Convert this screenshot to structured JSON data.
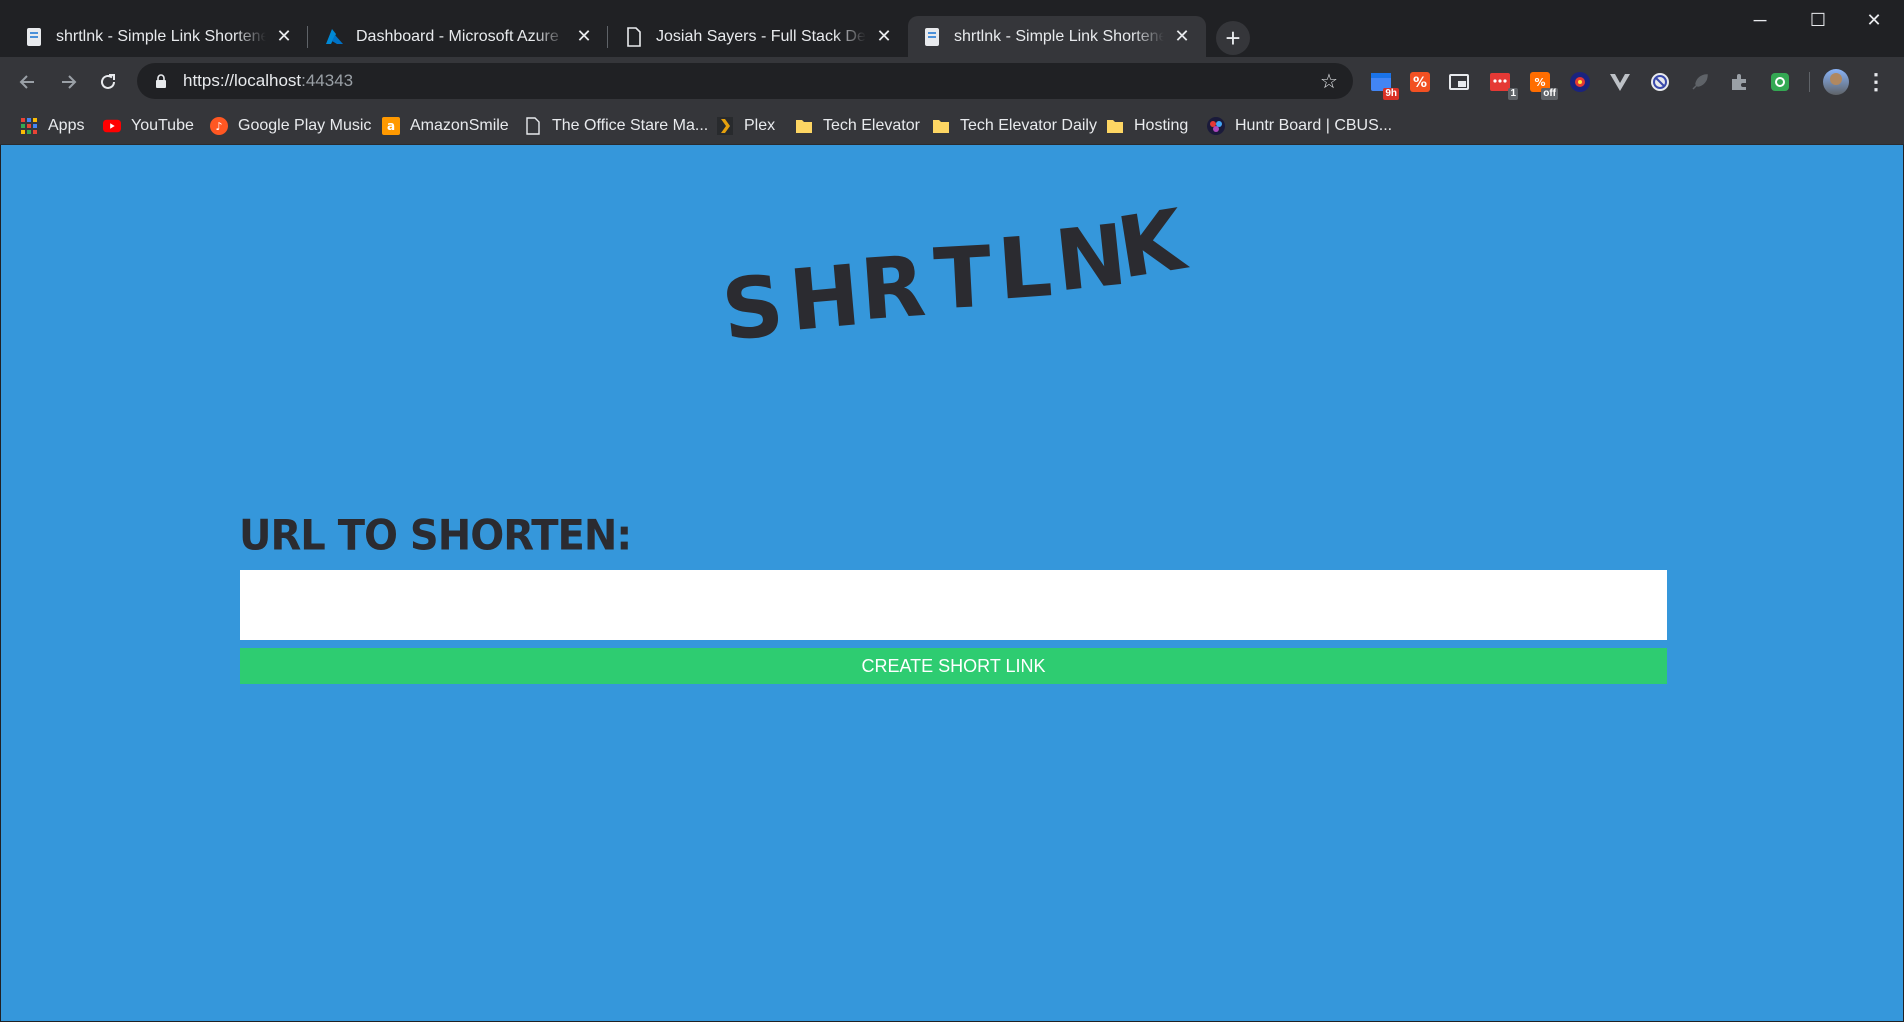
{
  "tabs": [
    {
      "title": "shrtlnk - Simple Link Shortener -",
      "favicon": "page-icon",
      "active": false
    },
    {
      "title": "Dashboard - Microsoft Azure",
      "favicon": "azure-icon",
      "active": false
    },
    {
      "title": "Josiah Sayers - Full Stack Develop",
      "favicon": "document-icon",
      "active": false
    },
    {
      "title": "shrtlnk - Simple Link Shortener -",
      "favicon": "page-icon",
      "active": true
    }
  ],
  "window_controls": {
    "minimize": "─",
    "maximize": "☐",
    "close": "✕"
  },
  "address_bar": {
    "url_prefix": "https://localhost",
    "url_port": ":44343"
  },
  "extensions": [
    {
      "name": "calendar-extension-icon",
      "badge": "9h",
      "badge_color": "#d93025"
    },
    {
      "name": "percent-extension-icon",
      "badge": "",
      "badge_color": ""
    },
    {
      "name": "picture-in-picture-icon",
      "badge": "",
      "badge_color": ""
    },
    {
      "name": "todo-extension-icon",
      "badge": "1",
      "badge_color": "#5f6368"
    },
    {
      "name": "coupon-extension-icon",
      "badge": "off",
      "badge_color": "#5f6368"
    },
    {
      "name": "globe-extension-icon",
      "badge": "",
      "badge_color": ""
    },
    {
      "name": "vue-devtools-icon",
      "badge": "",
      "badge_color": ""
    },
    {
      "name": "block-extension-icon",
      "badge": "",
      "badge_color": ""
    },
    {
      "name": "rocket-extension-icon",
      "badge": "",
      "badge_color": ""
    },
    {
      "name": "puzzle-extension-icon",
      "badge": "",
      "badge_color": ""
    },
    {
      "name": "gear-extension-icon",
      "badge": "",
      "badge_color": ""
    }
  ],
  "bookmarks": [
    {
      "label": "Apps",
      "icon": "apps-grid-icon"
    },
    {
      "label": "YouTube",
      "icon": "youtube-icon"
    },
    {
      "label": "Google Play Music",
      "icon": "play-music-icon"
    },
    {
      "label": "AmazonSmile",
      "icon": "amazon-icon"
    },
    {
      "label": "The Office Stare Ma...",
      "icon": "document-icon"
    },
    {
      "label": "Plex",
      "icon": "plex-icon"
    },
    {
      "label": "Tech Elevator",
      "icon": "folder-icon"
    },
    {
      "label": "Tech Elevator Daily",
      "icon": "folder-icon"
    },
    {
      "label": "Hosting",
      "icon": "folder-icon"
    },
    {
      "label": "Huntr Board | CBUS...",
      "icon": "huntr-icon"
    }
  ],
  "page": {
    "logo_text": "shrtlnk",
    "logo_letters": [
      "S",
      "H",
      "R",
      "T",
      "L",
      "N",
      "K"
    ],
    "field_label": "URL TO SHORTEN:",
    "input_value": "",
    "submit_label": "CREATE SHORT LINK",
    "colors": {
      "background": "#3597db",
      "button": "#2ecc71",
      "text": "#2b2b30"
    }
  }
}
